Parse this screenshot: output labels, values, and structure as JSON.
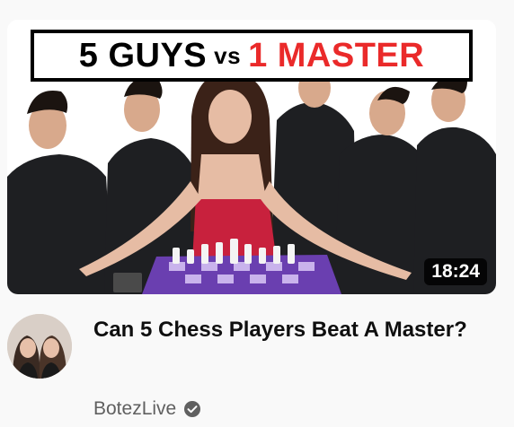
{
  "video": {
    "title": "Can 5 Chess Players Beat A Master?",
    "duration": "18:24",
    "channel": "BotezLive"
  },
  "thumbnail": {
    "banner_left": "5 GUYS",
    "banner_vs": "vs",
    "banner_right": "1 MASTER"
  },
  "colors": {
    "banner_accent": "#ea2a2a",
    "title_text": "#0f0f0f",
    "channel_text": "#606060",
    "background": "#f9f9f9"
  },
  "icons": {
    "verified": "verified-check-icon"
  }
}
